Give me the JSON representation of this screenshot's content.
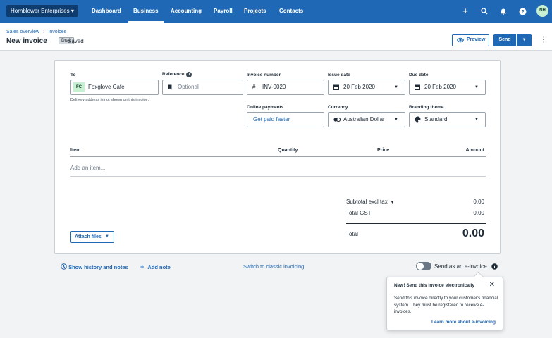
{
  "topnav": {
    "org": "Hornblower Enterprises",
    "org_caret": "▾",
    "items": [
      "Dashboard",
      "Business",
      "Accounting",
      "Payroll",
      "Projects",
      "Contacts"
    ],
    "active": "Business",
    "icons": {
      "add": "+",
      "search": "⌕",
      "notifications": "🔔",
      "help": "?"
    },
    "avatar": "NH"
  },
  "header": {
    "breadcrumb": [
      "Sales overview",
      "Invoices"
    ],
    "breadcrumb_sep": "›",
    "title": "New invoice",
    "status_badge": "Draft",
    "save_status": "Saved",
    "preview_label": "Preview",
    "send_label": "Send",
    "kebab": "⋮"
  },
  "form": {
    "to": {
      "label": "To",
      "contact_initials": "FC",
      "value": "Foxglove Cafe",
      "note": "Delivery address is not shown on this invoice."
    },
    "reference": {
      "label": "Reference",
      "info": "i",
      "placeholder": "Optional"
    },
    "invoice_number": {
      "label": "Invoice number",
      "prefix": "#",
      "value": "INV-0020"
    },
    "issue_date": {
      "label": "Issue date",
      "value": "20 Feb 2020"
    },
    "due_date": {
      "label": "Due date",
      "value": "20 Feb 2020"
    },
    "online_payments": {
      "label": "Online payments",
      "value": "Get paid faster"
    },
    "currency": {
      "label": "Currency",
      "value": "Australian Dollar"
    },
    "branding": {
      "label": "Branding theme",
      "value": "Standard"
    }
  },
  "items_table": {
    "columns": [
      "Item",
      "Quantity",
      "Price",
      "Amount"
    ],
    "add_item_placeholder": "Add an item..."
  },
  "totals": {
    "subtotal_label": "Subtotal excl tax",
    "subtotal_caret": "▾",
    "subtotal_value": "0.00",
    "gst_label": "Total GST",
    "gst_value": "0.00",
    "total_label": "Total",
    "total_value": "0.00"
  },
  "attach_label": "Attach files",
  "footer": {
    "history_label": "Show history and notes",
    "add_note_label": "Add note",
    "classic_label": "Switch to classic invoicing",
    "einvoice_label": "Send as an e-invoice",
    "einvoice_enabled": false
  },
  "popover": {
    "title": "New! Send this invoice electronically",
    "body": "Send this invoice directly to your customer's financial system. They must be registered to receive e-invoices.",
    "link": "Learn more about e-invoicing",
    "close": "✕"
  },
  "colors": {
    "brand": "#1f68b5",
    "org_background": "#0f3c6e",
    "avatar": "#c7efd1",
    "page_background": "#f2f3f4"
  }
}
